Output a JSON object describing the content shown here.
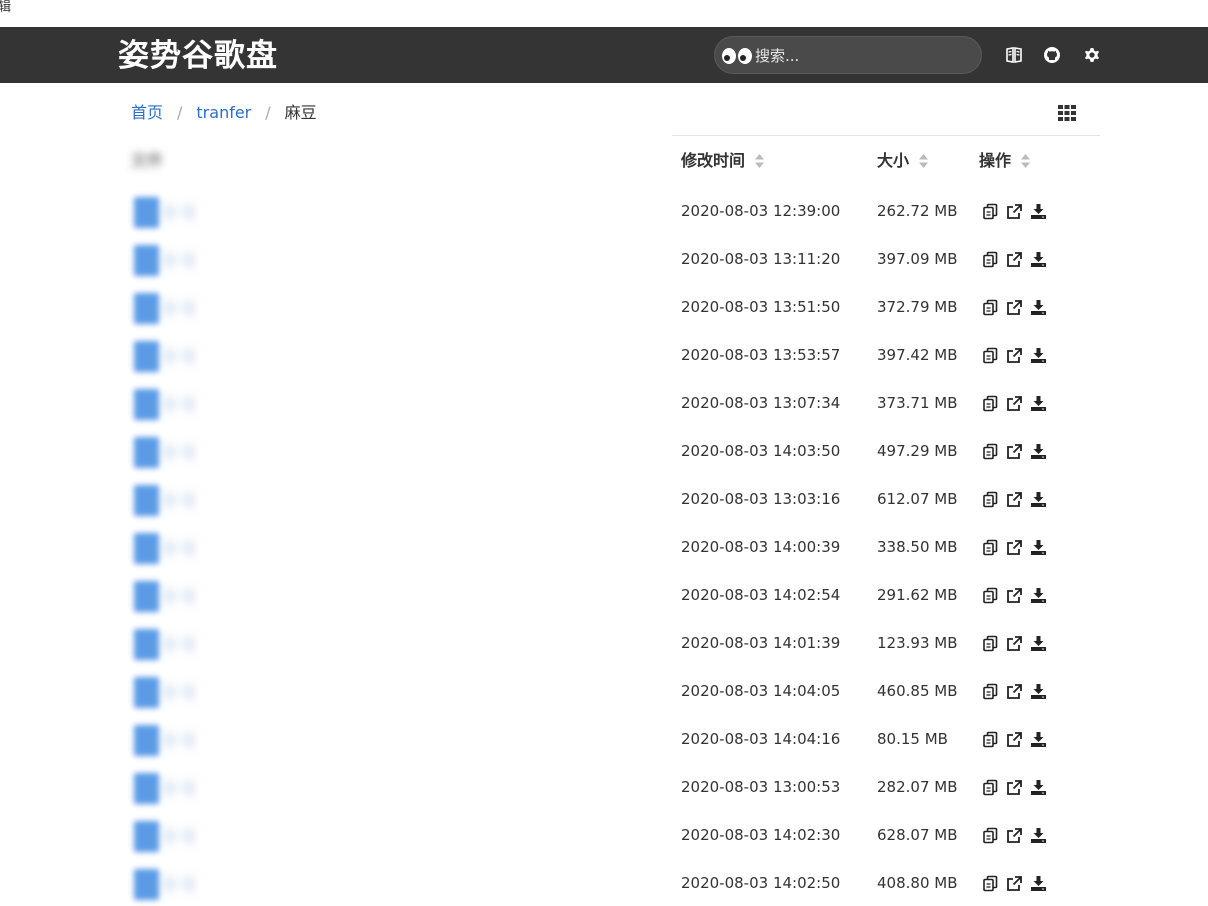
{
  "top_left_text": "辑",
  "header": {
    "brand": "姿势谷歌盘",
    "search": {
      "placeholder": "搜索..."
    },
    "icons": [
      "book-icon",
      "github-icon",
      "gear-icon"
    ]
  },
  "breadcrumb": {
    "home": "首页",
    "level1": "tranfer",
    "current": "麻豆",
    "separator": "/"
  },
  "table": {
    "columns": {
      "name": "文件",
      "modified": "修改时间",
      "size": "大小",
      "actions": "操作"
    },
    "rows": [
      {
        "name": "[···]",
        "modified": "2020-08-03 12:39:00",
        "size": "262.72 MB"
      },
      {
        "name": "[···]",
        "modified": "2020-08-03 13:11:20",
        "size": "397.09 MB"
      },
      {
        "name": "[···]",
        "modified": "2020-08-03 13:51:50",
        "size": "372.79 MB"
      },
      {
        "name": "[···]",
        "modified": "2020-08-03 13:53:57",
        "size": "397.42 MB"
      },
      {
        "name": "[···]",
        "modified": "2020-08-03 13:07:34",
        "size": "373.71 MB"
      },
      {
        "name": "[···]",
        "modified": "2020-08-03 14:03:50",
        "size": "497.29 MB"
      },
      {
        "name": "[···]",
        "modified": "2020-08-03 13:03:16",
        "size": "612.07 MB"
      },
      {
        "name": "[···]",
        "modified": "2020-08-03 14:00:39",
        "size": "338.50 MB"
      },
      {
        "name": "[···]",
        "modified": "2020-08-03 14:02:54",
        "size": "291.62 MB"
      },
      {
        "name": "[···]",
        "modified": "2020-08-03 14:01:39",
        "size": "123.93 MB"
      },
      {
        "name": "[···]",
        "modified": "2020-08-03 14:04:05",
        "size": "460.85 MB"
      },
      {
        "name": "[···]",
        "modified": "2020-08-03 14:04:16",
        "size": "80.15 MB"
      },
      {
        "name": "[···]",
        "modified": "2020-08-03 13:00:53",
        "size": "282.07 MB"
      },
      {
        "name": "[···]",
        "modified": "2020-08-03 14:02:30",
        "size": "628.07 MB"
      },
      {
        "name": "[···]",
        "modified": "2020-08-03 14:02:50",
        "size": "408.80 MB"
      }
    ],
    "row_actions": [
      "copy-link-icon",
      "open-external-icon",
      "download-icon"
    ]
  },
  "colors": {
    "navbar": "#343434",
    "link": "#2a6fc9",
    "file_icon": "#5b9be6"
  }
}
